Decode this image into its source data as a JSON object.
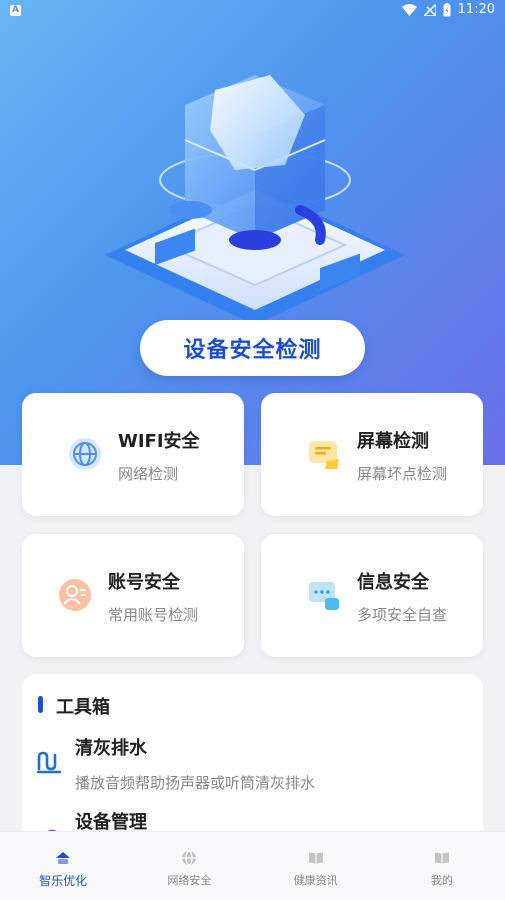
{
  "status_bar": {
    "app_badge": "A",
    "time": "11:20"
  },
  "hero": {
    "scan_button_label": "设备安全检测"
  },
  "cards": [
    {
      "title": "WIFI安全",
      "subtitle": "网络检测",
      "icon": "globe-icon"
    },
    {
      "title": "屏幕检测",
      "subtitle": "屏幕坏点检测",
      "icon": "screen-icon"
    },
    {
      "title": "账号安全",
      "subtitle": "常用账号检测",
      "icon": "user-icon"
    },
    {
      "title": "信息安全",
      "subtitle": "多项安全自查",
      "icon": "message-icon"
    }
  ],
  "toolbox": {
    "title": "工具箱",
    "items": [
      {
        "title": "清灰排水",
        "subtitle": "播放音频帮助扬声器或听筒清灰排水",
        "icon": "drain-icon"
      },
      {
        "title": "设备管理",
        "subtitle": "",
        "icon": "device-manage-icon"
      }
    ]
  },
  "tabs": [
    {
      "label": "智乐优化",
      "icon": "home-icon",
      "active": true
    },
    {
      "label": "网络安全",
      "icon": "globe-icon",
      "active": false
    },
    {
      "label": "健康资讯",
      "icon": "book-icon",
      "active": false
    },
    {
      "label": "我的",
      "icon": "book-icon",
      "active": false
    }
  ],
  "colors": {
    "accent": "#1a4fd0",
    "hero_start": "#69b6f4",
    "hero_end": "#6b70e8"
  }
}
